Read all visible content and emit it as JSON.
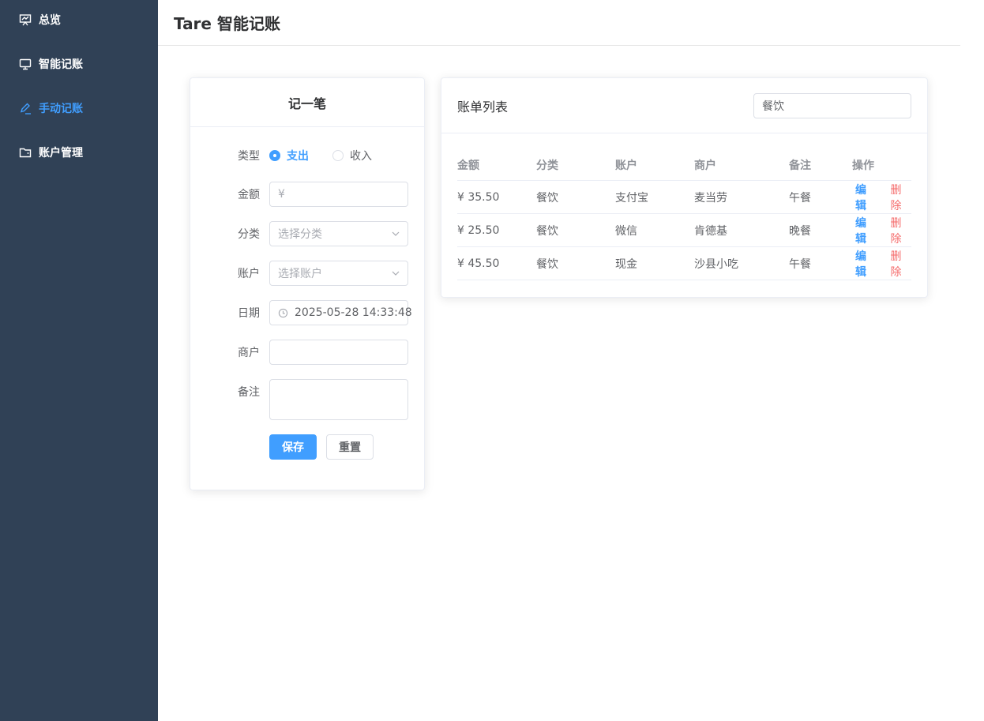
{
  "sidebar": {
    "items": [
      {
        "label": "总览",
        "icon": "presentation-chart-icon",
        "active": false
      },
      {
        "label": "智能记账",
        "icon": "monitor-icon",
        "active": false
      },
      {
        "label": "手动记账",
        "icon": "edit-pen-icon",
        "active": true
      },
      {
        "label": "账户管理",
        "icon": "wallet-icon",
        "active": false
      }
    ]
  },
  "header": {
    "title": "Tare 智能记账"
  },
  "form": {
    "title": "记一笔",
    "type_label": "类型",
    "type_options": [
      "支出",
      "收入"
    ],
    "type_selected": "支出",
    "amount_label": "金额",
    "amount_placeholder": "¥",
    "category_label": "分类",
    "category_placeholder": "选择分类",
    "account_label": "账户",
    "account_placeholder": "选择账户",
    "date_label": "日期",
    "date_value": "2025-05-28 14:33:48",
    "merchant_label": "商户",
    "merchant_value": "",
    "note_label": "备注",
    "note_value": "",
    "save_label": "保存",
    "reset_label": "重置"
  },
  "list": {
    "title": "账单列表",
    "search_value": "餐饮",
    "columns": [
      "金额",
      "分类",
      "账户",
      "商户",
      "备注",
      "操作"
    ],
    "rows": [
      {
        "amount": "¥ 35.50",
        "category": "餐饮",
        "account": "支付宝",
        "merchant": "麦当劳",
        "note": "午餐"
      },
      {
        "amount": "¥ 25.50",
        "category": "餐饮",
        "account": "微信",
        "merchant": "肯德基",
        "note": "晚餐"
      },
      {
        "amount": "¥ 45.50",
        "category": "餐饮",
        "account": "现金",
        "merchant": "沙县小吃",
        "note": "午餐"
      }
    ],
    "edit_label": "编辑",
    "delete_label": "删除"
  },
  "colors": {
    "sidebar_bg": "#304156",
    "accent": "#409eff",
    "danger": "#f56c6c"
  }
}
